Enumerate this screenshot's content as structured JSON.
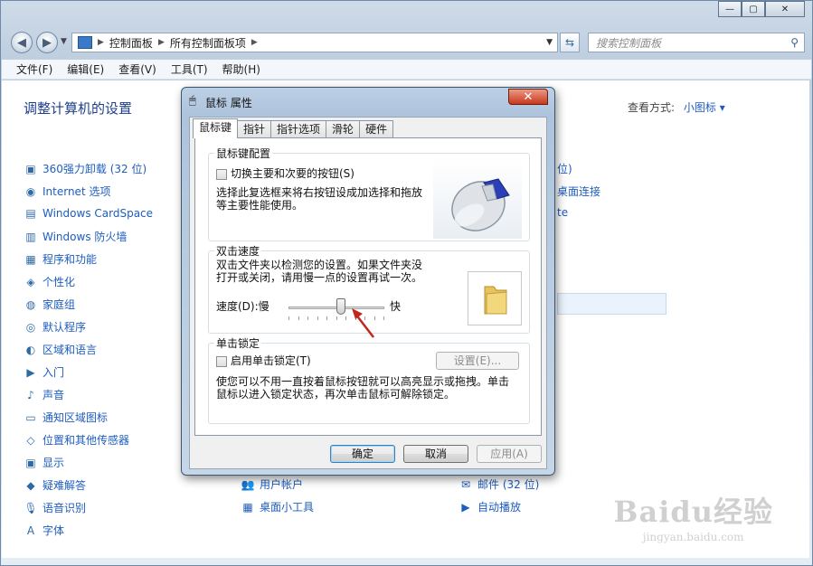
{
  "explorer": {
    "breadcrumbs": [
      "控制面板",
      "所有控制面板项"
    ],
    "search_placeholder": "搜索控制面板",
    "menu": [
      "文件(F)",
      "编辑(E)",
      "查看(V)",
      "工具(T)",
      "帮助(H)"
    ],
    "page_title": "调整计算机的设置",
    "view_by_label": "查看方式:",
    "view_by_value": "小图标 ▾",
    "items_col1": [
      "360强力卸载 (32 位)",
      "Internet 选项",
      "Windows CardSpace",
      "Windows 防火墙",
      "程序和功能",
      "个性化",
      "家庭组",
      "默认程序",
      "区域和语言",
      "入门",
      "声音",
      "通知区域图标",
      "位置和其他传感器",
      "显示",
      "疑难解答",
      "语音识别",
      "字体"
    ],
    "items_col2": [
      "用户帐户",
      "桌面小工具"
    ],
    "items_col3": [
      "邮件 (32 位)",
      "自动播放"
    ],
    "partial_col3": [
      "位)",
      "桌面连接",
      "te"
    ]
  },
  "dialog": {
    "title": "鼠标 属性",
    "tabs": [
      "鼠标键",
      "指针",
      "指针选项",
      "滑轮",
      "硬件"
    ],
    "active_tab": "鼠标键",
    "config_group": "鼠标键配置",
    "swap_label": "切换主要和次要的按钮(S)",
    "swap_desc_1": "选择此复选框来将右按钮设成加选择和拖放",
    "swap_desc_2": "等主要性能使用。",
    "dblclick_group": "双击速度",
    "dblclick_desc_1": "双击文件夹以检测您的设置。如果文件夹没",
    "dblclick_desc_2": "打开或关闭，请用慢一点的设置再试一次。",
    "speed_label": "速度(D):慢",
    "speed_fast": "快",
    "speed_value_fraction": 0.55,
    "clicklock_group": "单击锁定",
    "clicklock_label": "启用单击锁定(T)",
    "settings_button": "设置(E)...",
    "clicklock_desc_1": "使您可以不用一直按着鼠标按钮就可以高亮显示或拖拽。单击",
    "clicklock_desc_2": "鼠标以进入锁定状态，再次单击鼠标可解除锁定。",
    "ok": "确定",
    "cancel": "取消",
    "apply": "应用(A)"
  },
  "watermark": "Baidu经验",
  "watermark_sub": "jingyan.baidu.com"
}
